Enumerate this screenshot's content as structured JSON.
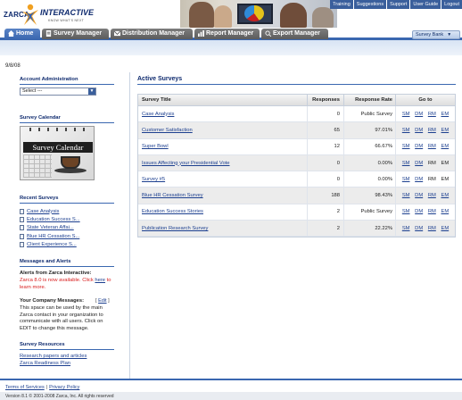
{
  "brand": {
    "logo_left": "ZARCA",
    "logo_right": "INTERACTIVE",
    "tagline": "KNOW WHAT'S NEXT"
  },
  "top_links": [
    "Training",
    "Suggestions",
    "Support",
    "User Guide",
    "Logout"
  ],
  "nav": {
    "tabs": [
      {
        "label": "Home",
        "icon": "home-icon",
        "active": true
      },
      {
        "label": "Survey Manager",
        "icon": "survey-manager-icon",
        "active": false
      },
      {
        "label": "Distribution Manager",
        "icon": "distribution-icon",
        "active": false
      },
      {
        "label": "Report Manager",
        "icon": "report-icon",
        "active": false
      },
      {
        "label": "Export Manager",
        "icon": "export-icon",
        "active": false
      }
    ],
    "survey_bank_label": "Survey Bank"
  },
  "date": "9/8/08",
  "left": {
    "account_admin_title": "Account Administration",
    "account_select_value": "Select ---",
    "survey_calendar_title": "Survey Calendar",
    "calendar_image_text": "Survey Calendar",
    "recent_surveys_title": "Recent Surveys",
    "recent_surveys": [
      "Case Analysis",
      "Education Success S...",
      "State Veteran Affai...",
      "Blue HR Cessation S...",
      "Client Experience S..."
    ],
    "messages_title": "Messages and Alerts",
    "alerts_title": "Alerts from Zarca Interactive:",
    "alert_text_before": "Zarca 8.0 is now available. Click ",
    "alert_link": "here",
    "alert_text_after": " to learn more.",
    "company_messages_title": "Your Company Messages:",
    "edit_open": "[",
    "edit_label": "Edit",
    "edit_close": "]",
    "company_message": "This space can be used by the main Zarca contact in your organization to communicate with all users. Click on EDIT to change this message.",
    "resources_title": "Survey Resources",
    "resources": [
      "Research papers and articles",
      "Zarca Readiness Plan"
    ]
  },
  "active_surveys": {
    "title": "Active Surveys",
    "headers": {
      "title": "Survey Title",
      "responses": "Responses",
      "rate": "Response Rate",
      "goto": "Go to"
    },
    "rows": [
      {
        "title": "Case Analysis",
        "responses": "0",
        "rate": "Public Survey",
        "links": [
          "SM",
          "DM",
          "RM",
          "EM"
        ],
        "linked": [
          true,
          true,
          true,
          true
        ]
      },
      {
        "title": "Customer Satisfaction",
        "responses": "65",
        "rate": "97.01%",
        "links": [
          "SM",
          "DM",
          "RM",
          "EM"
        ],
        "linked": [
          true,
          true,
          true,
          true
        ]
      },
      {
        "title": "Super Bowl",
        "responses": "12",
        "rate": "66.67%",
        "links": [
          "SM",
          "DM",
          "RM",
          "EM"
        ],
        "linked": [
          true,
          true,
          true,
          true
        ]
      },
      {
        "title": "Issues Affecting your Presidential Vote",
        "responses": "0",
        "rate": "0.00%",
        "links": [
          "SM",
          "DM",
          "RM",
          "EM"
        ],
        "linked": [
          true,
          true,
          false,
          false
        ]
      },
      {
        "title": "Survey #5",
        "responses": "0",
        "rate": "0.00%",
        "links": [
          "SM",
          "DM",
          "RM",
          "EM"
        ],
        "linked": [
          true,
          true,
          false,
          false
        ]
      },
      {
        "title": "Blue HR Cessation Survey",
        "responses": "188",
        "rate": "98.43%",
        "links": [
          "SM",
          "DM",
          "RM",
          "EM"
        ],
        "linked": [
          true,
          true,
          true,
          true
        ]
      },
      {
        "title": "Education Success Stories",
        "responses": "2",
        "rate": "Public Survey",
        "links": [
          "SM",
          "DM",
          "RM",
          "EM"
        ],
        "linked": [
          true,
          true,
          true,
          true
        ]
      },
      {
        "title": "Publication Research Survey",
        "responses": "2",
        "rate": "22.22%",
        "links": [
          "SM",
          "DM",
          "RM",
          "EM"
        ],
        "linked": [
          true,
          true,
          true,
          true
        ]
      }
    ]
  },
  "footer": {
    "terms": "Terms of Services",
    "separator": "|",
    "privacy": "Privacy Policy",
    "copyright": "Version 8.1 © 2001-2008 Zarca, Inc. All rights reserved"
  },
  "colors": {
    "brand_blue": "#3a67b0",
    "tab_grey": "#6b6b6b",
    "alert_red": "#d81b1b",
    "link_blue": "#1c3f8f"
  }
}
